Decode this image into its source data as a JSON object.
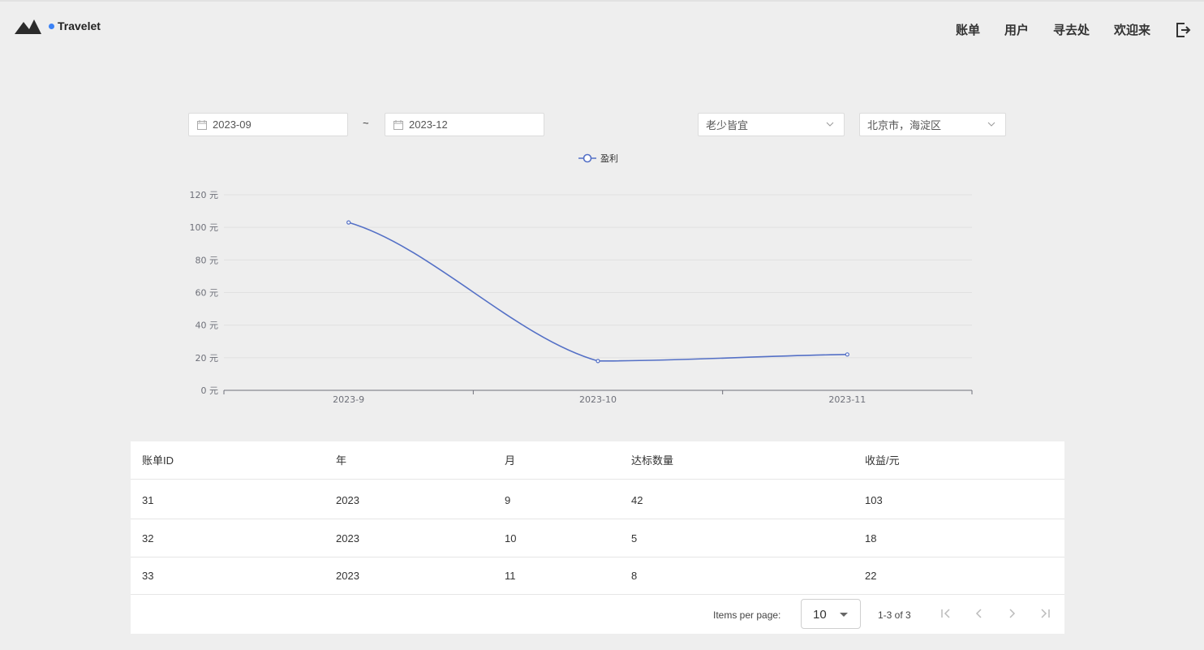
{
  "app": {
    "brand": "Travelet"
  },
  "nav": {
    "items": [
      {
        "label": "账单"
      },
      {
        "label": "用户"
      },
      {
        "label": "寻去处"
      },
      {
        "label": "欢迎来"
      }
    ],
    "logout_icon": "logout-icon"
  },
  "filters": {
    "start_date": "2023-09",
    "separator": "~",
    "end_date": "2023-12",
    "category_select": "老少皆宜",
    "region_select": "北京市，海淀区"
  },
  "chart_data": {
    "type": "line",
    "categories": [
      "2023-9",
      "2023-10",
      "2023-11"
    ],
    "series": [
      {
        "name": "盈利",
        "values": [
          103,
          18,
          22
        ],
        "color": "#5470c6"
      }
    ],
    "y_ticks": [
      "0 元",
      "20 元",
      "40 元",
      "60 元",
      "80 元",
      "100 元",
      "120 元"
    ],
    "ylim": [
      0,
      120
    ],
    "smooth": true,
    "legend": "top-center",
    "grid": true
  },
  "table": {
    "headers": [
      "账单ID",
      "年",
      "月",
      "达标数量",
      "收益/元"
    ],
    "rows": [
      [
        "31",
        "2023",
        "9",
        "42",
        "103"
      ],
      [
        "32",
        "2023",
        "10",
        "5",
        "18"
      ],
      [
        "33",
        "2023",
        "11",
        "8",
        "22"
      ]
    ]
  },
  "paginator": {
    "items_per_page_label": "Items per page:",
    "page_size": "10",
    "range_label": "1-3 of 3"
  }
}
